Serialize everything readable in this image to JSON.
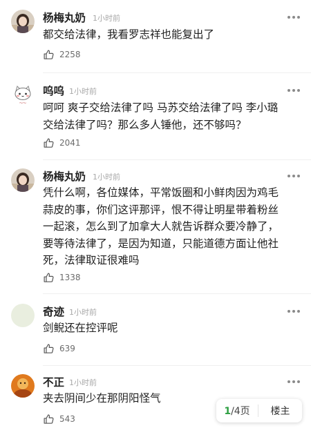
{
  "comments": [
    {
      "name": "杨梅丸奶",
      "time": "1小时前",
      "text": "都交给法律，我看罗志祥也能复出了",
      "likes": "2258",
      "avatar": "photo-woman-dark-hair"
    },
    {
      "name": "呜呜",
      "time": "1小时前",
      "text": "呵呵 爽子交给法律了吗 马苏交给法律了吗 李小璐\n交给法律了吗？那么多人锤他，还不够吗？",
      "likes": "2041",
      "avatar": "cartoon-cat"
    },
    {
      "name": "杨梅丸奶",
      "time": "1小时前",
      "text": "凭什么啊，各位媒体，平常饭圈和小鲜肉因为鸡毛\n蒜皮的事，你们这评那评，恨不得让明星带着粉丝\n一起滚，怎么到了加拿大人就告诉群众要冷静了，\n要等待法律了，是因为知道，只能道德方面让他社\n死，法律取证很难吗",
      "likes": "1338",
      "avatar": "photo-woman-dark-hair"
    },
    {
      "name": "奇迹",
      "time": "1小时前",
      "text": "剑鲵还在控评呢",
      "likes": "639",
      "avatar": "plain-circle"
    },
    {
      "name": "不正",
      "time": "1小时前",
      "text": "夹去阴间少在那阴阳怪气",
      "likes": "543",
      "avatar": "photo-orange-portrait"
    }
  ],
  "pager": {
    "current": "1",
    "total_suffix": "/4页",
    "host_label": "楼主"
  },
  "colors": {
    "accent_green": "#2ea043",
    "meta_gray": "#a8a8a8"
  }
}
